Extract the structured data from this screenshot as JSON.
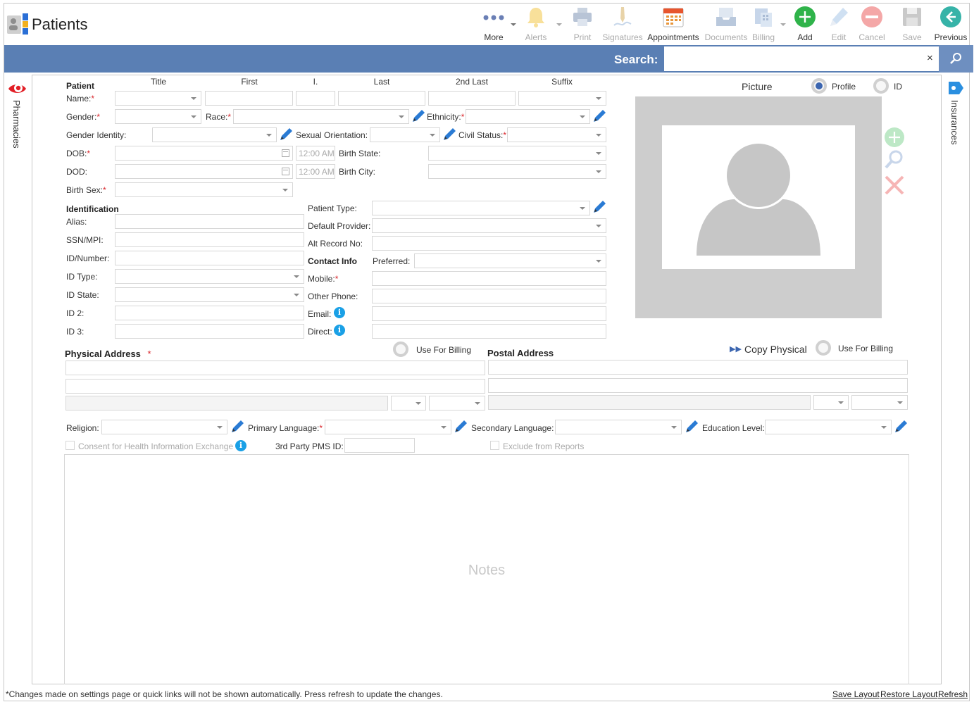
{
  "header": {
    "title": "Patients",
    "toolbar": [
      {
        "label": "More",
        "icon": "more-icon",
        "enabled": true
      },
      {
        "label": "Alerts",
        "icon": "bell-icon",
        "enabled": false
      },
      {
        "label": "Print",
        "icon": "printer-icon",
        "enabled": false
      },
      {
        "label": "Signatures",
        "icon": "signature-pen-icon",
        "enabled": false
      },
      {
        "label": "Appointments",
        "icon": "calendar-icon",
        "enabled": true
      },
      {
        "label": "Documents",
        "icon": "inbox-tray-icon",
        "enabled": false
      },
      {
        "label": "Billing",
        "icon": "billing-calculator-icon",
        "enabled": false
      },
      {
        "label": "Add",
        "icon": "plus-circle-icon",
        "enabled": true
      },
      {
        "label": "Edit",
        "icon": "pencil-icon",
        "enabled": false
      },
      {
        "label": "Cancel",
        "icon": "cancel-circle-icon",
        "enabled": false
      },
      {
        "label": "Save",
        "icon": "floppy-disk-icon",
        "enabled": false
      },
      {
        "label": "Previous",
        "icon": "arrow-left-circle-icon",
        "enabled": true
      }
    ]
  },
  "search": {
    "label": "Search:",
    "value": "",
    "clear": "×"
  },
  "side_tabs": {
    "left": "Pharmacies",
    "right": "Insurances"
  },
  "patient": {
    "section": "Patient",
    "columns": {
      "title": "Title",
      "first": "First",
      "initial": "I.",
      "last": "Last",
      "last2": "2nd Last",
      "suffix": "Suffix"
    },
    "name_label": "Name:",
    "gender_label": "Gender:",
    "race_label": "Race:",
    "ethnicity_label": "Ethnicity:",
    "gender_identity_label": "Gender Identity:",
    "sexual_orientation_label": "Sexual Orientation:",
    "civil_status_label": "Civil Status:",
    "dob_label": "DOB:",
    "dob_time": "12:00 AM",
    "birth_state_label": "Birth State:",
    "dod_label": "DOD:",
    "dod_time": "12:00 AM",
    "birth_city_label": "Birth City:",
    "birth_sex_label": "Birth Sex:",
    "required_mark": "*"
  },
  "identification": {
    "section": "Identification",
    "alias_label": "Alias:",
    "ssn_label": "SSN/MPI:",
    "id_number_label": "ID/Number:",
    "id_type_label": "ID Type:",
    "id_state_label": "ID State:",
    "id2_label": "ID 2:",
    "id3_label": "ID 3:"
  },
  "details": {
    "patient_type_label": "Patient Type:",
    "default_provider_label": "Default Provider:",
    "alt_record_label": "Alt Record No:",
    "contact_section": "Contact Info",
    "preferred_label": "Preferred:",
    "mobile_label": "Mobile:",
    "other_phone_label": "Other Phone:",
    "email_label": "Email:",
    "direct_label": "Direct:",
    "info_glyph": "i"
  },
  "picture": {
    "title": "Picture",
    "profile_label": "Profile",
    "id_label": "ID",
    "selected": "Profile"
  },
  "address": {
    "physical_title": "Physical Address",
    "physical_required": "*",
    "use_for_billing_physical": "Use For Billing",
    "postal_title": "Postal Address",
    "copy_physical": "Copy Physical",
    "copy_glyph": "▶▶",
    "use_for_billing_postal": "Use For Billing"
  },
  "other": {
    "religion_label": "Religion:",
    "primary_language_label": "Primary Language:",
    "secondary_language_label": "Secondary Language:",
    "education_level_label": "Education Level:",
    "consent_label": "Consent for Health Information Exchange",
    "third_party_label": "3rd Party PMS ID:",
    "exclude_label": "Exclude from Reports",
    "notes_placeholder": "Notes"
  },
  "footer": {
    "note": "*Changes made on settings page or quick links will not be shown automatically. Press refresh to update the changes.",
    "save_layout": "Save Layout",
    "restore_layout": "Restore Layout",
    "refresh": "Refresh"
  },
  "colors": {
    "accent": "#5a7fb4",
    "required": "#d9262c",
    "add_green": "#2fb34a",
    "info_blue": "#1aa0e6"
  }
}
